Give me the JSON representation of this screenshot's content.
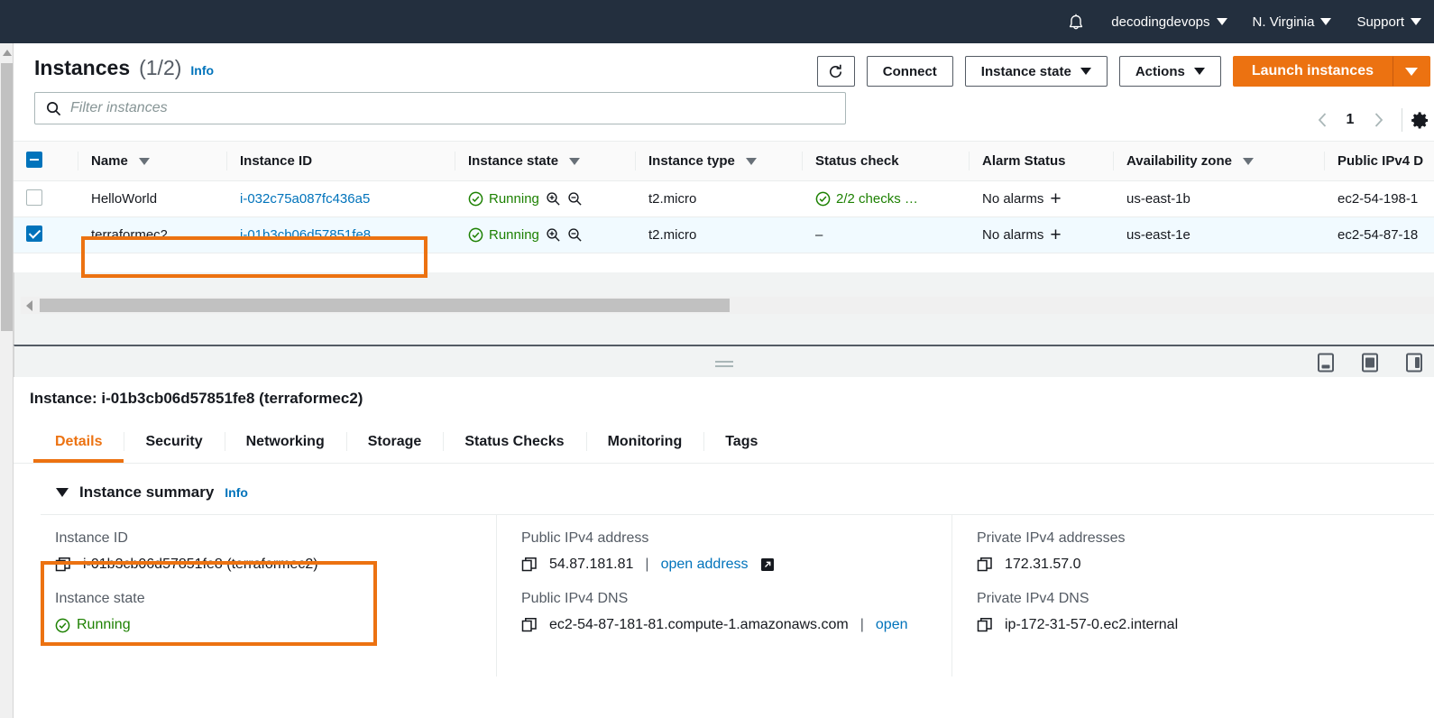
{
  "topnav": {
    "notifications_icon": "bell-icon",
    "account": "decodingdevops",
    "region": "N. Virginia",
    "support": "Support"
  },
  "page": {
    "title": "Instances",
    "count": "(1/2)",
    "info_label": "Info"
  },
  "toolbar": {
    "refresh_icon": "refresh-icon",
    "connect_label": "Connect",
    "instance_state_label": "Instance state",
    "actions_label": "Actions",
    "launch_label": "Launch instances"
  },
  "search": {
    "icon": "search-icon",
    "placeholder": "Filter instances",
    "value": ""
  },
  "pagination": {
    "prev_icon": "chevron-left-icon",
    "page": "1",
    "next_icon": "chevron-right-icon",
    "settings_icon": "gear-icon"
  },
  "table": {
    "columns": [
      {
        "label": "Name",
        "sortable": true
      },
      {
        "label": "Instance ID",
        "sortable": false
      },
      {
        "label": "Instance state",
        "sortable": true
      },
      {
        "label": "Instance type",
        "sortable": true
      },
      {
        "label": "Status check",
        "sortable": false
      },
      {
        "label": "Alarm Status",
        "sortable": false
      },
      {
        "label": "Availability zone",
        "sortable": true
      },
      {
        "label": "Public IPv4 D",
        "sortable": false
      }
    ],
    "rows": [
      {
        "selected": false,
        "name": "HelloWorld",
        "instance_id": "i-032c75a087fc436a5",
        "state": "Running",
        "type": "t2.micro",
        "status_check": "2/2 checks …",
        "status_check_ok": true,
        "alarm_status": "No alarms",
        "availability_zone": "us-east-1b",
        "public_ipv4_dns": "ec2-54-198-1"
      },
      {
        "selected": true,
        "name": "terraformec2",
        "instance_id": "i-01b3cb06d57851fe8",
        "state": "Running",
        "type": "t2.micro",
        "status_check": "–",
        "status_check_ok": false,
        "alarm_status": "No alarms",
        "availability_zone": "us-east-1e",
        "public_ipv4_dns": "ec2-54-87-18"
      }
    ]
  },
  "details": {
    "title": "Instance: i-01b3cb06d57851fe8 (terraformec2)",
    "tabs": [
      {
        "label": "Details",
        "active": true
      },
      {
        "label": "Security",
        "active": false
      },
      {
        "label": "Networking",
        "active": false
      },
      {
        "label": "Storage",
        "active": false
      },
      {
        "label": "Status Checks",
        "active": false
      },
      {
        "label": "Monitoring",
        "active": false
      },
      {
        "label": "Tags",
        "active": false
      }
    ],
    "summary": {
      "heading": "Instance summary",
      "info_label": "Info",
      "instance_id_label": "Instance ID",
      "instance_id_value": "i-01b3cb06d57851fe8 (terraformec2)",
      "instance_state_label": "Instance state",
      "instance_state_value": "Running",
      "public_ipv4_address_label": "Public IPv4 address",
      "public_ipv4_address_value": "54.87.181.81",
      "public_ipv4_address_link": "open address",
      "public_ipv4_dns_label": "Public IPv4 DNS",
      "public_ipv4_dns_value": "ec2-54-87-181-81.compute-1.amazonaws.com",
      "public_ipv4_dns_link": "open",
      "private_ipv4_addresses_label": "Private IPv4 addresses",
      "private_ipv4_addresses_value": "172.31.57.0",
      "private_ipv4_dns_label": "Private IPv4 DNS",
      "private_ipv4_dns_value": "ip-172-31-57-0.ec2.internal"
    },
    "split_icons": [
      "layout-bottom-icon",
      "layout-full-icon",
      "layout-side-icon"
    ]
  },
  "colors": {
    "nav_bg": "#232f3e",
    "accent_orange": "#ec7211",
    "link_blue": "#0073bb",
    "success_green": "#1d8102",
    "selected_row": "#f1faff",
    "selected_border": "#00a1c9"
  }
}
